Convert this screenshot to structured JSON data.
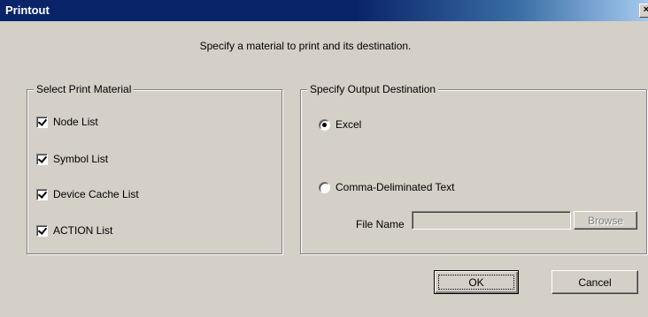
{
  "window": {
    "title": "Printout",
    "close_glyph": "×"
  },
  "prompt": "Specify a material to print and its destination.",
  "material_group": {
    "legend": "Select Print Material",
    "items": [
      {
        "label": "Node List",
        "checked": true
      },
      {
        "label": "Symbol List",
        "checked": true
      },
      {
        "label": "Device Cache List",
        "checked": true
      },
      {
        "label": "ACTION List",
        "checked": true
      }
    ]
  },
  "output_group": {
    "legend": "Specify Output Destination",
    "options": [
      {
        "label": "Excel",
        "selected": true
      },
      {
        "label": "Comma-Deliminated Text",
        "selected": false
      }
    ],
    "file_name_label": "File Name",
    "file_name_value": "",
    "browse_label": "Browse"
  },
  "buttons": {
    "ok": "OK",
    "cancel": "Cancel"
  },
  "colors": {
    "face": "#d4d0c8",
    "title_active": "#0a246a",
    "title_gradient_end": "#a6caf0"
  }
}
